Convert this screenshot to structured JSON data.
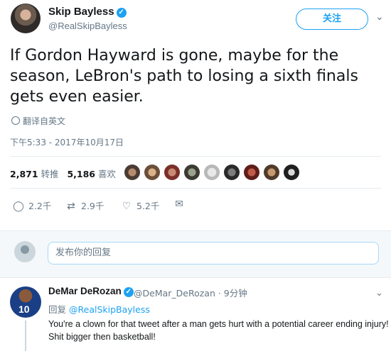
{
  "tweet": {
    "author_name": "Skip Bayless",
    "author_handle": "@RealSkipBayless",
    "follow_label": "关注",
    "text": "If Gordon Hayward is gone, maybe for the season, LeBron's path to losing a sixth finals gets even easier.",
    "translate_label": "翻译自英文",
    "timestamp": "下午5:33 - 2017年10月17日",
    "retweets_count": "2,871",
    "retweets_label": "转推",
    "likes_count": "5,186",
    "likes_label": "喜欢"
  },
  "actions": {
    "reply_count": "2.2千",
    "retweet_count": "2.9千",
    "like_count": "5.2千"
  },
  "reply_box": {
    "placeholder": "发布你的回复"
  },
  "reply": {
    "author_name": "DeMar DeRozan",
    "author_handle": "@DeMar_DeRozan · 9分钟",
    "avatar_number": "10",
    "replying_to_prefix": "回复",
    "replying_to_handle": "@RealSkipBayless",
    "text": "You're a clown for that tweet after a man gets hurt with a potential career ending injury! Shit bigger then basketball!"
  },
  "icons": {
    "verified": "verified-badge-icon",
    "globe": "globe-icon",
    "reply": "reply-icon",
    "retweet": "retweet-icon",
    "like": "heart-icon",
    "dm": "message-icon",
    "more": "chevron-down-icon"
  },
  "colors": {
    "accent": "#1da1f2",
    "secondary_text": "#657786",
    "reply_area_bg": "#f5f8fa"
  }
}
